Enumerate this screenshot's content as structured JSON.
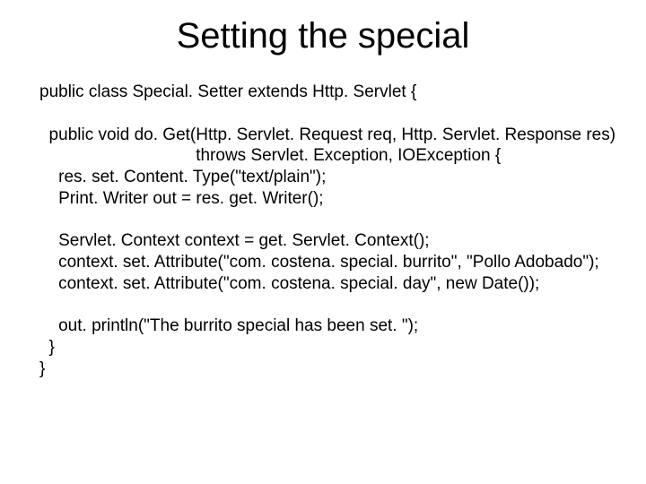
{
  "title": "Setting the special",
  "code": {
    "l1": "public class Special. Setter extends Http. Servlet {",
    "l2": "",
    "l3": "  public void do. Get(Http. Servlet. Request req, Http. Servlet. Response res)",
    "l4": "                                 throws Servlet. Exception, IOException {",
    "l5": "    res. set. Content. Type(\"text/plain\");",
    "l6": "    Print. Writer out = res. get. Writer();",
    "l7": "",
    "l8": "    Servlet. Context context = get. Servlet. Context();",
    "l9": "    context. set. Attribute(\"com. costena. special. burrito\", \"Pollo Adobado\");",
    "l10": "    context. set. Attribute(\"com. costena. special. day\", new Date());",
    "l11": "",
    "l12": "    out. println(\"The burrito special has been set. \");",
    "l13": "  }",
    "l14": "}"
  }
}
